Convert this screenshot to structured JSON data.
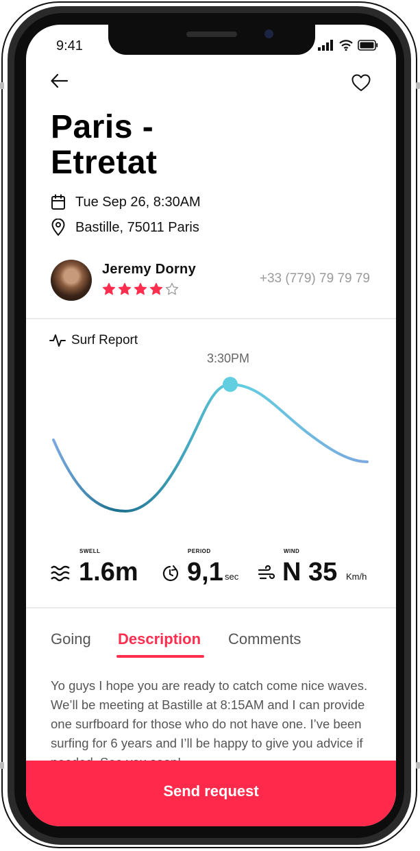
{
  "status": {
    "time": "9:41"
  },
  "trip": {
    "title_line1": "Paris -",
    "title_line2": "Etretat",
    "date": "Tue Sep 26, 8:30AM",
    "location": "Bastille, 75011 Paris"
  },
  "host": {
    "name": "Jeremy Dorny",
    "rating": 4,
    "rating_max": 5,
    "phone": "+33 (779) 79 79 79"
  },
  "surf_report": {
    "title": "Surf Report",
    "peak_time": "3:30PM",
    "swell": {
      "caption": "SWELL",
      "value": "1.6m"
    },
    "period": {
      "caption": "PERIOD",
      "value": "9,1",
      "unit": "sec"
    },
    "wind": {
      "caption": "WIND",
      "value": "N 35",
      "unit": "Km/h"
    }
  },
  "tabs": [
    {
      "label": "Going",
      "active": false
    },
    {
      "label": "Description",
      "active": true
    },
    {
      "label": "Comments",
      "active": false
    }
  ],
  "description": "Yo guys I hope you are ready to catch come nice waves. We’ll be meeting at Bastille at 8:15AM and I can provide one surfboard for those who do not have one. I’ve been surfing for 6 years and I’ll be happy to give you advice if needed. See you soon!",
  "cta": {
    "label": "Send request"
  },
  "colors": {
    "accent": "#ff2d4e",
    "wave_start": "#7aa9e0",
    "wave_deep": "#1b6f8d",
    "wave_peak": "#62cfe0"
  },
  "icons": {
    "back": "arrow-left-icon",
    "favorite": "heart-icon",
    "date": "calendar-icon",
    "location": "map-pin-icon",
    "report": "activity-icon",
    "swell": "waves-icon",
    "period": "clock-icon",
    "wind": "wind-icon"
  }
}
